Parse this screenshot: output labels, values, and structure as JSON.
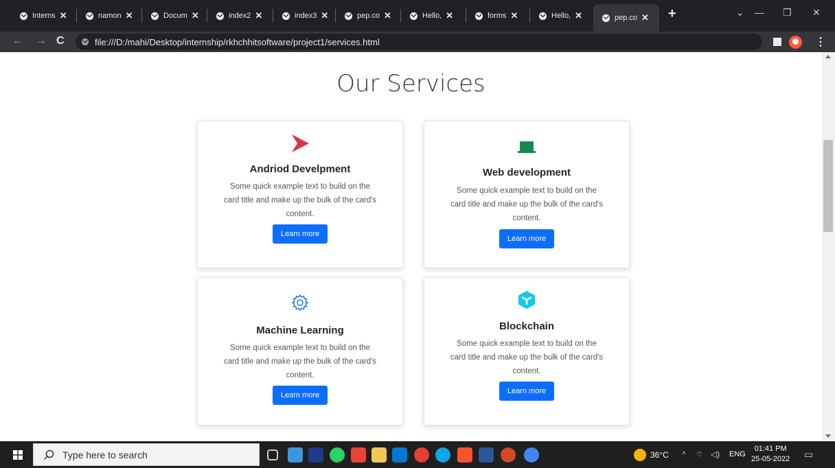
{
  "browser": {
    "tabs": [
      {
        "label": "Interns",
        "active": false
      },
      {
        "label": "namon",
        "active": false
      },
      {
        "label": "Docum",
        "active": false
      },
      {
        "label": "index2",
        "active": false
      },
      {
        "label": "index3",
        "active": false
      },
      {
        "label": "pep.co",
        "active": false
      },
      {
        "label": "Hello,",
        "active": false
      },
      {
        "label": "forms",
        "active": false
      },
      {
        "label": "Hello,",
        "active": false
      },
      {
        "label": "pep.co",
        "active": true
      }
    ],
    "close_glyph": "✕",
    "new_tab_glyph": "+",
    "url": "file:///D:/mahi/Desktop/internship/rkhchhitsoftware/project1/services.html"
  },
  "page": {
    "heading": "Our Services",
    "cards": [
      {
        "title": "Andriod Develpment",
        "text": "Some quick example text to build on the card title and make up the bulk of the card's content.",
        "button": "Learn more",
        "icon": "play-store-icon",
        "icon_color": "#dc3545"
      },
      {
        "title": "Web development",
        "text": "Some quick example text to build on the card title and make up the bulk of the card's content.",
        "button": "Learn more",
        "icon": "laptop-icon",
        "icon_color": "#198754"
      },
      {
        "title": "Machine Learning",
        "text": "Some quick example text to build on the card title and make up the bulk of the card's content.",
        "button": "Learn more",
        "icon": "gear-icon",
        "icon_color": "#0d6efd"
      },
      {
        "title": "Blockchain",
        "text": "Some quick example text to build on the card title and make up the bulk of the card's content.",
        "button": "Learn more",
        "icon": "box-icon",
        "icon_color": "#0dcaf0"
      }
    ],
    "accent": "#0d6efd"
  },
  "taskbar": {
    "search_placeholder": "Type here to search",
    "temperature": "36°C",
    "language": "ENG",
    "time": "01:41 PM",
    "date": "25-05-2022"
  }
}
